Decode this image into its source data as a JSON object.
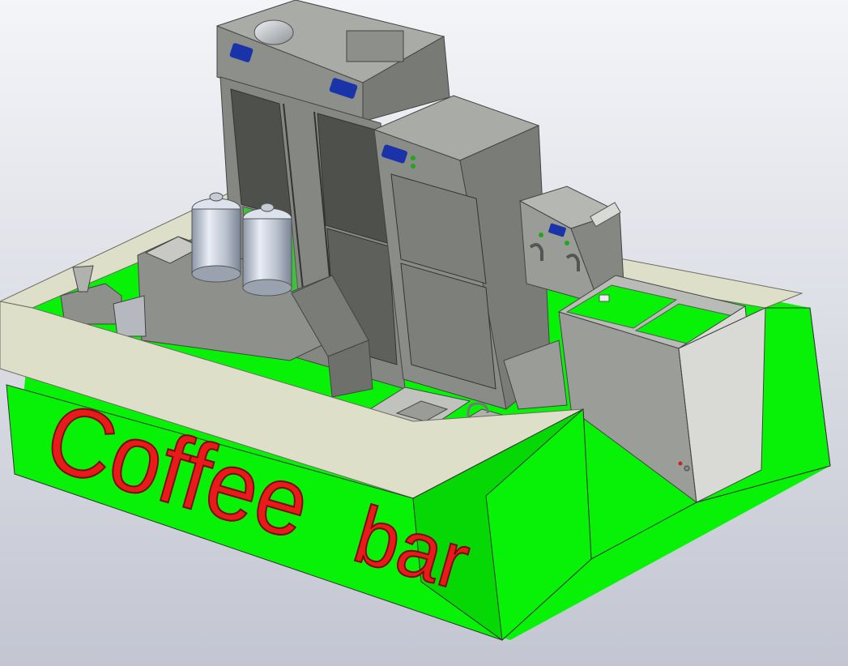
{
  "sign": {
    "word1": "Coffee",
    "word2": "bar"
  },
  "colors": {
    "body_green": "#08f208",
    "counter_top": "#dedfc9",
    "steel": "#9ea09b",
    "steel_dark": "#6e706b",
    "panel_blue": "#1a33a8",
    "letter_red": "#e81a1a"
  }
}
